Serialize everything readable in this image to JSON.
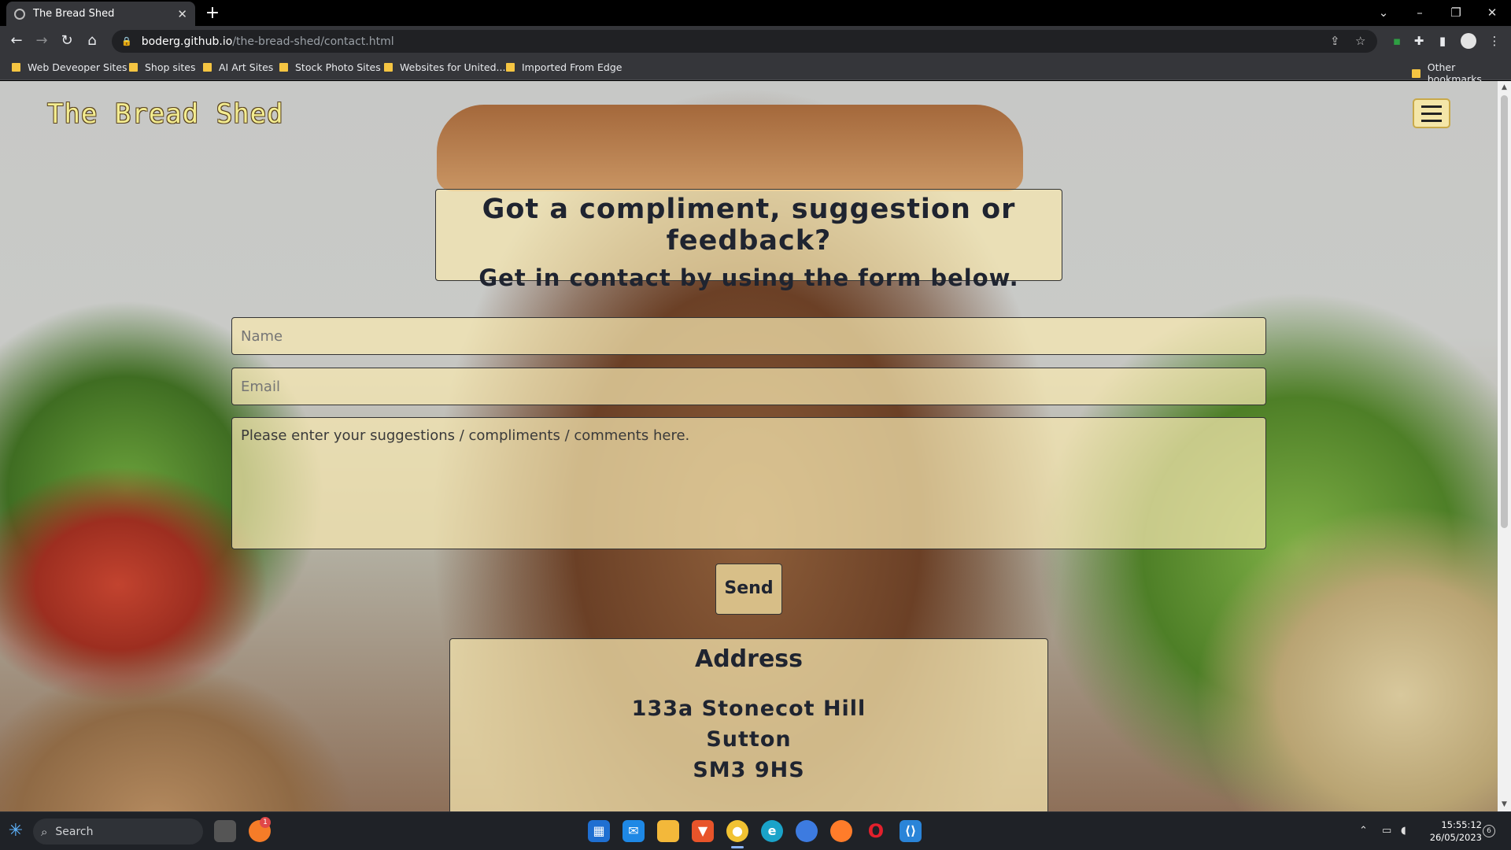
{
  "browser": {
    "tab_title": "The Bread Shed",
    "tab_close": "✕",
    "new_tab": "+",
    "url_host": "boderg.github.io",
    "url_path": "/the-bread-shed/contact.html",
    "bookmarks": [
      "Web Deveoper Sites",
      "Shop sites",
      "AI Art Sites",
      "Stock Photo Sites",
      "Websites for United...",
      "Imported From Edge"
    ],
    "other_bookmarks": "Other bookmarks"
  },
  "site": {
    "brand": "The Bread Shed",
    "heading": "Got a compliment, suggestion or feedback?",
    "subheading": "Get in contact by using the form below.",
    "form": {
      "name_placeholder": "Name",
      "email_placeholder": "Email",
      "message_placeholder": "Please enter your suggestions / compliments / comments here.",
      "send_label": "Send"
    },
    "address": {
      "title": "Address",
      "line1": "133a Stonecot Hill",
      "line2": "Sutton",
      "line3": "SM3 9HS"
    }
  },
  "taskbar": {
    "search_label": "Search",
    "time": "15:55:12",
    "date": "26/05/2023",
    "notification_count": "6",
    "badge_count": "1",
    "pinned_icons": [
      "store-icon",
      "mail-icon",
      "file-explorer-icon",
      "brave-icon",
      "chrome-icon",
      "edge-icon",
      "firefox-dev-icon",
      "firefox-icon",
      "opera-icon",
      "vscode-icon"
    ]
  },
  "colors": {
    "brand_text": "#f3ec90",
    "card_bg": "#f7e7b0",
    "chrome_dark": "#35363a",
    "taskbar_bg": "#1f2227"
  }
}
